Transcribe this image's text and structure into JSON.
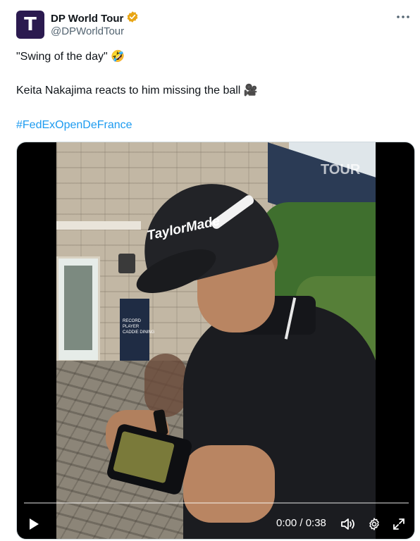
{
  "account": {
    "display_name": "DP World Tour",
    "handle": "@DPWorldTour",
    "verified": true,
    "avatar_letter": "T",
    "avatar_color": "#2b1a4f",
    "badge_color": "#e8a514"
  },
  "tweet": {
    "line1": "\"Swing of the day\" 🤣",
    "line2": "Keita Nakajima reacts to him missing the ball 🎥",
    "hashtag": "#FedExOpenDeFrance"
  },
  "video": {
    "cap_logo": "TaylorMade",
    "sign_text": "RECORD\nPLAYER\nCADDIE DINING",
    "watermark": "TOUR",
    "current_time": "0:00",
    "duration": "0:38",
    "time_label": "0:00 / 0:38",
    "progress_fraction": 0.0
  },
  "icons": {
    "more": "more-options-icon",
    "verified": "verified-badge-icon",
    "play": "play-icon",
    "volume": "volume-icon",
    "settings": "settings-gear-icon",
    "fullscreen": "fullscreen-icon"
  },
  "colors": {
    "text": "#0f1419",
    "muted": "#536471",
    "link": "#1d9bf0"
  }
}
